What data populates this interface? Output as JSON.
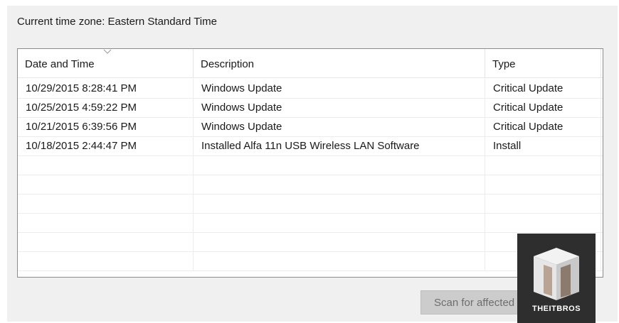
{
  "timezone": {
    "label": "Current time zone: Eastern Standard Time"
  },
  "table": {
    "columns": [
      "Date and Time",
      "Description",
      "Type"
    ],
    "rows": [
      {
        "date": "10/29/2015 8:28:41 PM",
        "description": "Windows Update",
        "type": "Critical Update"
      },
      {
        "date": "10/25/2015 4:59:22 PM",
        "description": "Windows Update",
        "type": "Critical Update"
      },
      {
        "date": "10/21/2015 6:39:56 PM",
        "description": "Windows Update",
        "type": "Critical Update"
      },
      {
        "date": "10/18/2015 2:44:47 PM",
        "description": "Installed Alfa 11n USB Wireless LAN Software",
        "type": "Install"
      }
    ],
    "sort_icon": "chevron-down-icon"
  },
  "scan_button": {
    "label": "Scan for affected programs"
  },
  "watermark": {
    "label": "THEITBROS"
  }
}
